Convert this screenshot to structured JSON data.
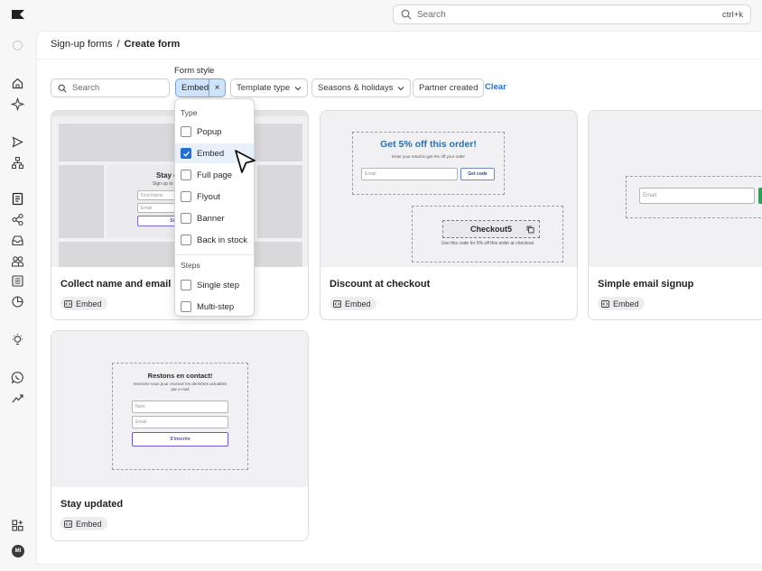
{
  "topbar": {
    "search_placeholder": "Search",
    "search_shortcut": "ctrl+k"
  },
  "breadcrumb": {
    "parent": "Sign-up forms",
    "separator": "/",
    "current": "Create form"
  },
  "filters": {
    "form_style_label": "Form style",
    "search_placeholder": "Search",
    "active_chip": "Embed",
    "active_chip_remove": "×",
    "template_type": "Template type",
    "seasons_holidays": "Seasons & holidays",
    "partner_created": "Partner created",
    "clear": "Clear"
  },
  "menu": {
    "type_header": "Type",
    "type_options": [
      {
        "label": "Popup",
        "checked": false
      },
      {
        "label": "Embed",
        "checked": true
      },
      {
        "label": "Full page",
        "checked": false
      },
      {
        "label": "Flyout",
        "checked": false
      },
      {
        "label": "Banner",
        "checked": false
      },
      {
        "label": "Back in stock",
        "checked": false
      }
    ],
    "steps_header": "Steps",
    "steps_options": [
      {
        "label": "Single step",
        "checked": false
      },
      {
        "label": "Multi-step",
        "checked": false
      }
    ]
  },
  "cards": [
    {
      "title": "Collect name and email",
      "tag": "Embed",
      "preview": {
        "heading": "Stay c",
        "sub": "Sign up to g",
        "field1": "First Name",
        "field2": "Email",
        "button": "Si"
      }
    },
    {
      "title": "Discount at checkout",
      "tag": "Embed",
      "preview": {
        "heading": "Get 5% off this order!",
        "sub": "Enter your email to get 5% off your order",
        "field": "Email",
        "button": "Get code",
        "code": "Checkout5",
        "code_note": "Use this code for 5% off this order at checkout"
      }
    },
    {
      "title": "Simple email signup",
      "tag": "Embed",
      "preview": {
        "field": "Email"
      }
    },
    {
      "title": "Stay updated",
      "tag": "Embed",
      "preview": {
        "heading": "Restons en contact!",
        "sub": "Inscrivez-vous pour recevoir les dernières actualités par e-mail",
        "field1": "Nom",
        "field2": "Email",
        "button": "S'inscrire"
      }
    }
  ],
  "user": {
    "initials": "MI"
  },
  "colors": {
    "accent": "#1f6fd6",
    "chip_bg": "#cfe4fb",
    "discount_heading": "#2a6fb0",
    "button_purple": "#6b5bd6"
  },
  "icons": [
    "logo-icon",
    "search-icon",
    "circle-icon",
    "home-icon",
    "sparkle-icon",
    "send-icon",
    "flow-icon",
    "form-icon",
    "share-icon",
    "inbox-icon",
    "users-icon",
    "catalog-icon",
    "pie-icon",
    "lightbulb-icon",
    "whatsapp-icon",
    "trend-icon",
    "apps-icon",
    "embed-icon",
    "copy-icon",
    "cursor-icon"
  ]
}
